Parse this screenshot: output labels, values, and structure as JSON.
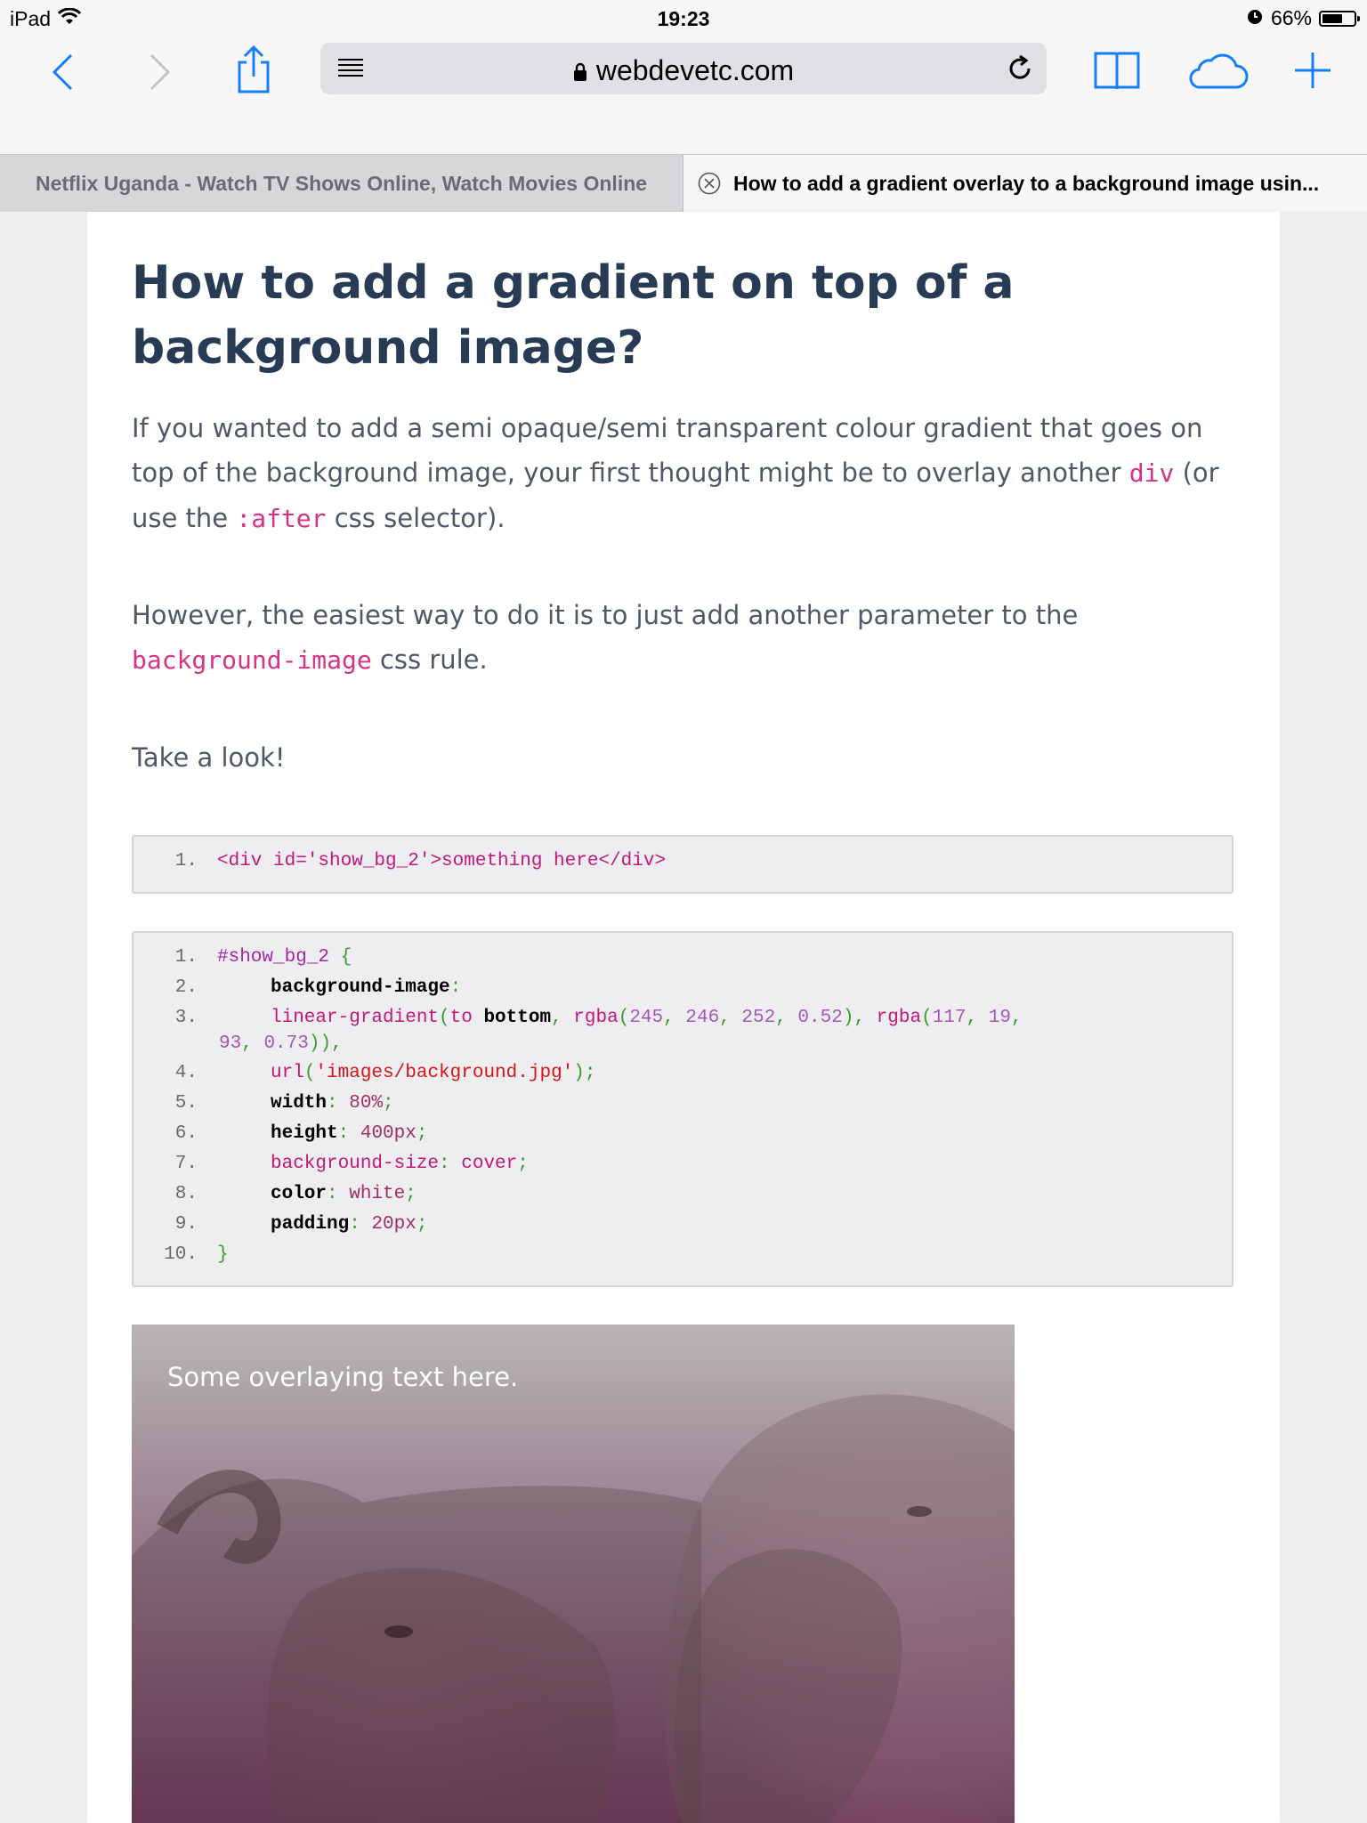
{
  "status_bar": {
    "device": "iPad",
    "time": "19:23",
    "battery": "66%",
    "battery_level": 0.66
  },
  "toolbar": {
    "url": "webdevetc.com",
    "back_icon": "chevron-left-icon",
    "forward_icon": "chevron-right-icon",
    "share_icon": "share-icon",
    "reader_icon": "reader-mode-icon",
    "reload_icon": "reload-icon",
    "bookmarks_icon": "bookmarks-icon",
    "cloud_icon": "cloud-icon",
    "new_tab_icon": "plus-icon",
    "accent": "#157efb"
  },
  "tabs": [
    {
      "title": "Netflix Uganda - Watch TV Shows Online, Watch Movies Online",
      "active": false
    },
    {
      "title": "How to add a gradient overlay to a background image usin...",
      "active": true
    }
  ],
  "article": {
    "title": "How to add a gradient on top of a background image?",
    "p1_a": "If you wanted to add a semi opaque/semi transparent colour gradient that goes on top of the background image, your first thought might be to overlay another ",
    "p1_code1": "div",
    "p1_b": " (or use the ",
    "p1_code2": ":after",
    "p1_c": " css selector).",
    "p2_a": "However, the easiest way to do it is to just add another parameter to the ",
    "p2_code": "background-image",
    "p2_b": " css rule.",
    "p3": "Take a look!",
    "code1": {
      "lines": [
        {
          "n": "1.",
          "text": "<div id='show_bg_2'>something here</div>"
        }
      ]
    },
    "code2": {
      "line_numbers": [
        "1.",
        "2.",
        "3.",
        "4.",
        "5.",
        "6.",
        "7.",
        "8.",
        "9.",
        "10."
      ],
      "l1_sel": "#show_bg_2",
      "l1_brace": " {",
      "l2_prop": "background-image",
      "l2_colon": ":",
      "l3_fn": "linear-gradient",
      "l3_p1": "(",
      "l3_to": "to ",
      "l3_kw": "bottom",
      "l3_p2": ", ",
      "l3_rgba1": "rgba",
      "l3_p3": "(",
      "l3_n1": "245",
      "l3_c1": ", ",
      "l3_n2": "246",
      "l3_c2": ", ",
      "l3_n3": "252",
      "l3_c3": ", ",
      "l3_n4": "0.52",
      "l3_p4": "), ",
      "l3_rgba2": "rgba",
      "l3_p5": "(",
      "l3_n5": "117",
      "l3_c5": ", ",
      "l3_n6": "19",
      "l3_c6": ",",
      "l3b_n7": "93",
      "l3b_c7": ", ",
      "l3b_n8": "0.73",
      "l3b_p": ")),",
      "l4_fn": "url",
      "l4_p1": "(",
      "l4_str": "'images/background.jpg'",
      "l4_p2": ");",
      "l5_prop": "width",
      "l5_colon": ": ",
      "l5_val": "80%",
      "l5_semi": ";",
      "l6_prop": "height",
      "l6_colon": ": ",
      "l6_val": "400px",
      "l6_semi": ";",
      "l7_prop": "background-size",
      "l7_colon": ": ",
      "l7_val": "cover",
      "l7_semi": ";",
      "l8_prop": "color",
      "l8_colon": ": ",
      "l8_val": "white",
      "l8_semi": ";",
      "l9_prop": "padding",
      "l9_colon": ": ",
      "l9_val": "20px",
      "l9_semi": ";",
      "l10_brace": "}"
    },
    "hero_text": "Some overlaying text here."
  }
}
